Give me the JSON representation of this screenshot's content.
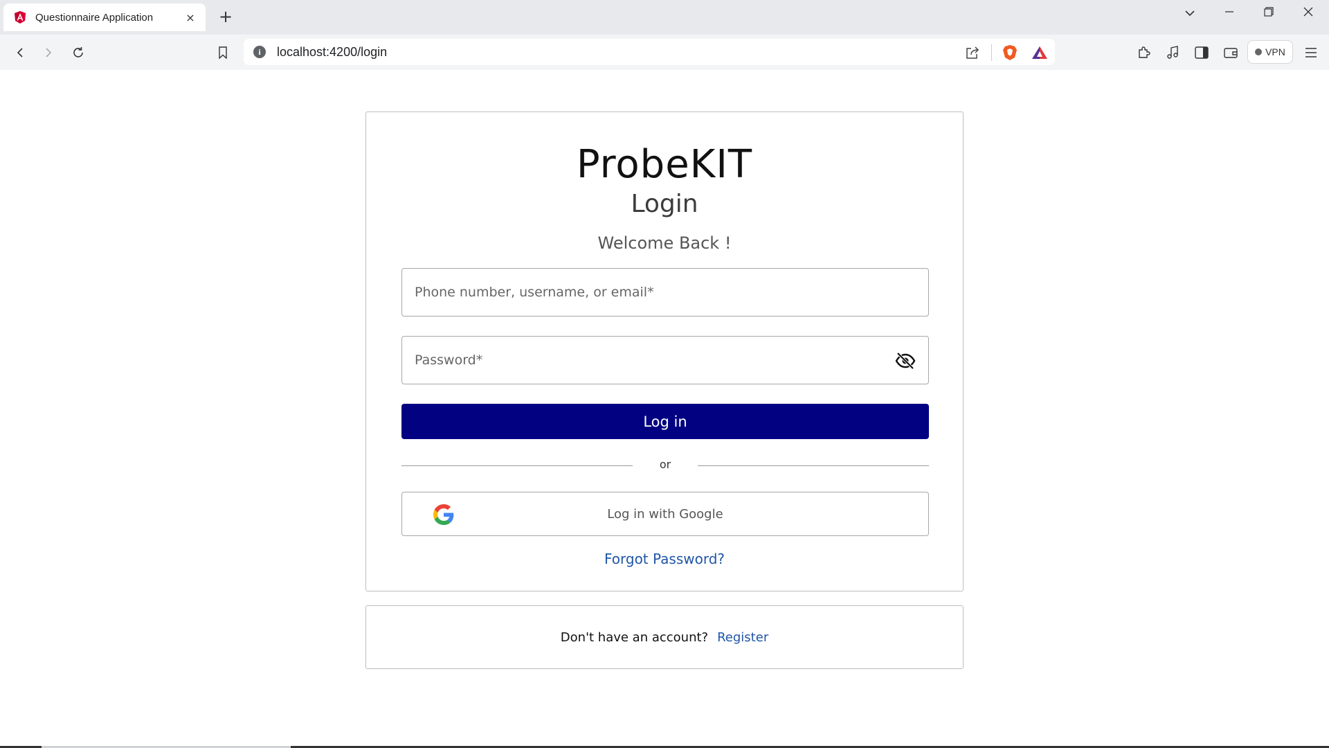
{
  "browser": {
    "tab": {
      "title": "Questionnaire Application",
      "close_icon": "×"
    },
    "new_tab_icon": "+",
    "address": {
      "url": "localhost:4200/login"
    },
    "vpn_label": "VPN"
  },
  "page": {
    "brand": "ProbeKIT",
    "heading": "Login",
    "welcome": "Welcome Back !",
    "username_placeholder": "Phone number, username, or email*",
    "password_placeholder": "Password*",
    "login_button": "Log in",
    "divider_text": "or",
    "google_button": "Log in with Google",
    "forgot_password": "Forgot Password?",
    "no_account": "Don't have an account?",
    "register_link": "Register"
  },
  "colors": {
    "primary_button": "#020181",
    "link": "#1f56a6"
  }
}
